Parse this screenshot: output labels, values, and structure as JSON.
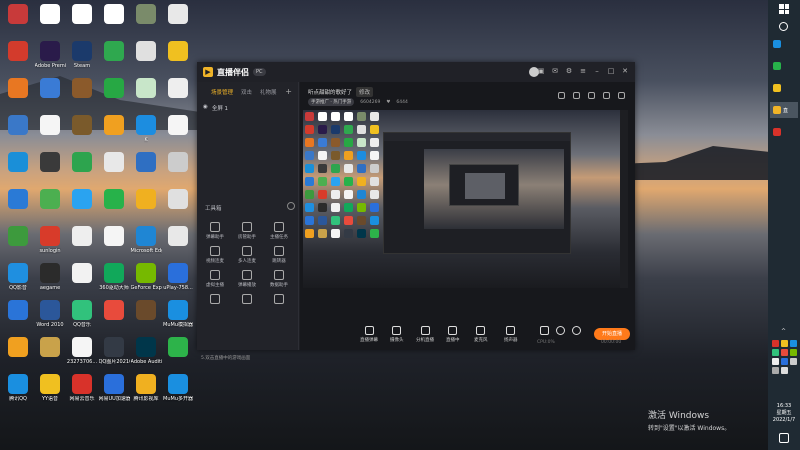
{
  "desktop": {
    "icons": [
      {
        "label": "",
        "color": "#c83a3a"
      },
      {
        "label": "",
        "color": "#ffffff"
      },
      {
        "label": "",
        "color": "#ffffff"
      },
      {
        "label": "",
        "color": "#ffffff"
      },
      {
        "label": "",
        "color": "#7a8b6a"
      },
      {
        "label": "",
        "color": "#e8e8e8"
      },
      {
        "label": "",
        "color": "#d33b2c"
      },
      {
        "label": "Adobe Premie...",
        "color": "#2a1b4a"
      },
      {
        "label": "Steam",
        "color": "#1b3a6b"
      },
      {
        "label": "",
        "color": "#2fa84f"
      },
      {
        "label": "",
        "color": "#e0e0e0"
      },
      {
        "label": "",
        "color": "#f0c020"
      },
      {
        "label": "",
        "color": "#e87722"
      },
      {
        "label": "",
        "color": "#3a7bd5"
      },
      {
        "label": "",
        "color": "#8b5a2b"
      },
      {
        "label": "",
        "color": "#27a844"
      },
      {
        "label": "",
        "color": "#c8e6c9"
      },
      {
        "label": "",
        "color": "#eeeeee"
      },
      {
        "label": "",
        "color": "#3a78c8"
      },
      {
        "label": "",
        "color": "#f5f5f5"
      },
      {
        "label": "",
        "color": "#7a5a2b"
      },
      {
        "label": "",
        "color": "#f0a020"
      },
      {
        "label": "K",
        "color": "#1c8de0"
      },
      {
        "label": "",
        "color": "#f5f5f5"
      },
      {
        "label": "",
        "color": "#1a8fd8"
      },
      {
        "label": "",
        "color": "#3a3a3a"
      },
      {
        "label": "",
        "color": "#2da44e"
      },
      {
        "label": "",
        "color": "#e8e8e8"
      },
      {
        "label": "",
        "color": "#2f6fc2"
      },
      {
        "label": "",
        "color": "#cccccc"
      },
      {
        "label": "",
        "color": "#2a7ad6"
      },
      {
        "label": "",
        "color": "#4caf50"
      },
      {
        "label": "",
        "color": "#2aa3f0"
      },
      {
        "label": "",
        "color": "#27b24a"
      },
      {
        "label": "",
        "color": "#f0b020"
      },
      {
        "label": "",
        "color": "#e0e0e0"
      },
      {
        "label": "",
        "color": "#3d9a3d"
      },
      {
        "label": "sunlogin",
        "color": "#d83b2a"
      },
      {
        "label": "",
        "color": "#eeeeee"
      },
      {
        "label": "",
        "color": "#f5f5f5"
      },
      {
        "label": "Microsoft Edge",
        "color": "#1f86d4"
      },
      {
        "label": "",
        "color": "#e8e8e8"
      },
      {
        "label": "QQ影音",
        "color": "#1f8fe0"
      },
      {
        "label": "aegame",
        "color": "#2b2b2b"
      },
      {
        "label": "",
        "color": "#f2f2f2"
      },
      {
        "label": "360驱动大师",
        "color": "#11a85a"
      },
      {
        "label": "GeForce Experience",
        "color": "#76b900"
      },
      {
        "label": "uPlay-758...",
        "color": "#2a6fdb"
      },
      {
        "label": "",
        "color": "#2a74d8"
      },
      {
        "label": "Word 2010",
        "color": "#2b579a"
      },
      {
        "label": "QQ音乐",
        "color": "#31c27c"
      },
      {
        "label": "",
        "color": "#e84b3c"
      },
      {
        "label": "",
        "color": "#6a4a2b"
      },
      {
        "label": "MuMu模拟器",
        "color": "#1a8fe0"
      },
      {
        "label": "",
        "color": "#f0a020"
      },
      {
        "label": "",
        "color": "#c9a24a"
      },
      {
        "label": "23273706...",
        "color": "#f5f5f5"
      },
      {
        "label": "QQ图片20210911...",
        "color": "#333a45"
      },
      {
        "label": "Adobe Audition...",
        "color": "#00364a"
      },
      {
        "label": "",
        "color": "#2db34a"
      },
      {
        "label": "腾讯QQ",
        "color": "#1a8fe0"
      },
      {
        "label": "YY语音",
        "color": "#f0c020"
      },
      {
        "label": "网易云音乐",
        "color": "#d8322a"
      },
      {
        "label": "网易UU加速器",
        "color": "#2a6fdb"
      },
      {
        "label": "腾讯影视库",
        "color": "#f0b020"
      },
      {
        "label": "MuMu多开器",
        "color": "#1a8fe0"
      }
    ],
    "activation": {
      "line1": "激活 Windows",
      "line2": "转到\"设置\"以激活 Windows。"
    }
  },
  "app": {
    "name": "直播伴侣",
    "version": "PC",
    "tabs": [
      "场景管理",
      "双击",
      "礼物展"
    ],
    "scene_label": "全屏 1",
    "tools_header": "工具箱",
    "tools": [
      {
        "label": "弹幕助手"
      },
      {
        "label": "房管助手"
      },
      {
        "label": "主播任务"
      },
      {
        "label": "视频连麦"
      },
      {
        "label": "多人连麦"
      },
      {
        "label": "跳转器"
      },
      {
        "label": "虚拟主播"
      },
      {
        "label": "弹幕播放"
      },
      {
        "label": "数据助手"
      },
      {
        "label": ""
      },
      {
        "label": ""
      },
      {
        "label": ""
      }
    ],
    "side_note": "5.双击直播中的游戏画面",
    "room_title": "听点甜甜的歌好了",
    "edit_label": "修改",
    "room_category": "手游推广 · 热门手游",
    "room_id": "6604269",
    "room_fans": "6444",
    "bottom_bar": [
      {
        "label": "直播弹幕"
      },
      {
        "label": "摄像头"
      },
      {
        "label": "分机直播"
      },
      {
        "label": "直播中"
      },
      {
        "label": "麦克风"
      },
      {
        "label": "扬声器"
      }
    ],
    "go_live_label": "开始直播",
    "status_time": "00:00:00",
    "status_cpu": "CPU:0%"
  },
  "taskbar": {
    "apps": [
      {
        "label": "",
        "color": "#1a8fe0",
        "active": false
      },
      {
        "label": "",
        "color": "#27b24a",
        "active": false
      },
      {
        "label": "",
        "color": "#f0c020",
        "active": false
      },
      {
        "label": "直",
        "color": "#f0b428",
        "active": true
      },
      {
        "label": "",
        "color": "#d8322a",
        "active": false
      }
    ],
    "clock_time": "16:33",
    "clock_weekday": "星期五",
    "clock_date": "2022/1/7"
  }
}
